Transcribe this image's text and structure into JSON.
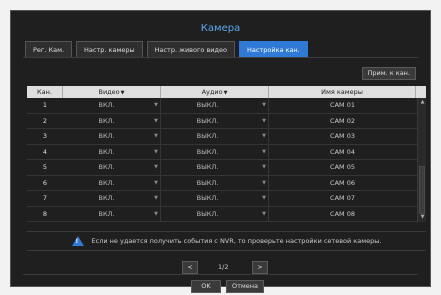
{
  "dialog": {
    "title": "Камера",
    "tabs": [
      {
        "label": "Рег. Кам."
      },
      {
        "label": "Настр. камеры"
      },
      {
        "label": "Настр. живого видео"
      },
      {
        "label": "Настройка кан."
      }
    ],
    "active_tab": 3,
    "copy_button": "Прим. к кан.",
    "table": {
      "headers": {
        "channel": "Кан.",
        "video": "Видео",
        "audio": "Аудио",
        "camera_name": "Имя камеры"
      },
      "rows": [
        {
          "ch": "1",
          "video": "ВКЛ.",
          "audio": "ВЫКЛ.",
          "name": "CAM 01"
        },
        {
          "ch": "2",
          "video": "ВКЛ.",
          "audio": "ВЫКЛ.",
          "name": "CAM 02"
        },
        {
          "ch": "3",
          "video": "ВКЛ.",
          "audio": "ВЫКЛ.",
          "name": "CAM 03"
        },
        {
          "ch": "4",
          "video": "ВКЛ.",
          "audio": "ВЫКЛ.",
          "name": "CAM 04"
        },
        {
          "ch": "5",
          "video": "ВКЛ.",
          "audio": "ВЫКЛ.",
          "name": "CAM 05"
        },
        {
          "ch": "6",
          "video": "ВКЛ.",
          "audio": "ВЫКЛ.",
          "name": "CAM 06"
        },
        {
          "ch": "7",
          "video": "ВКЛ.",
          "audio": "ВЫКЛ.",
          "name": "CAM 07"
        },
        {
          "ch": "8",
          "video": "ВКЛ.",
          "audio": "ВЫКЛ.",
          "name": "CAM 08"
        }
      ]
    },
    "notice": "Если не удается получить события с NVR, то проверьте настройки сетевой камеры.",
    "pager": {
      "text": "1/2",
      "prev": "<",
      "next": ">"
    },
    "ok_button": "OK",
    "cancel_button": "Отмена"
  },
  "colors": {
    "accent": "#2e7ad6",
    "title": "#5aa9f0",
    "background": "#1f1f1f"
  }
}
